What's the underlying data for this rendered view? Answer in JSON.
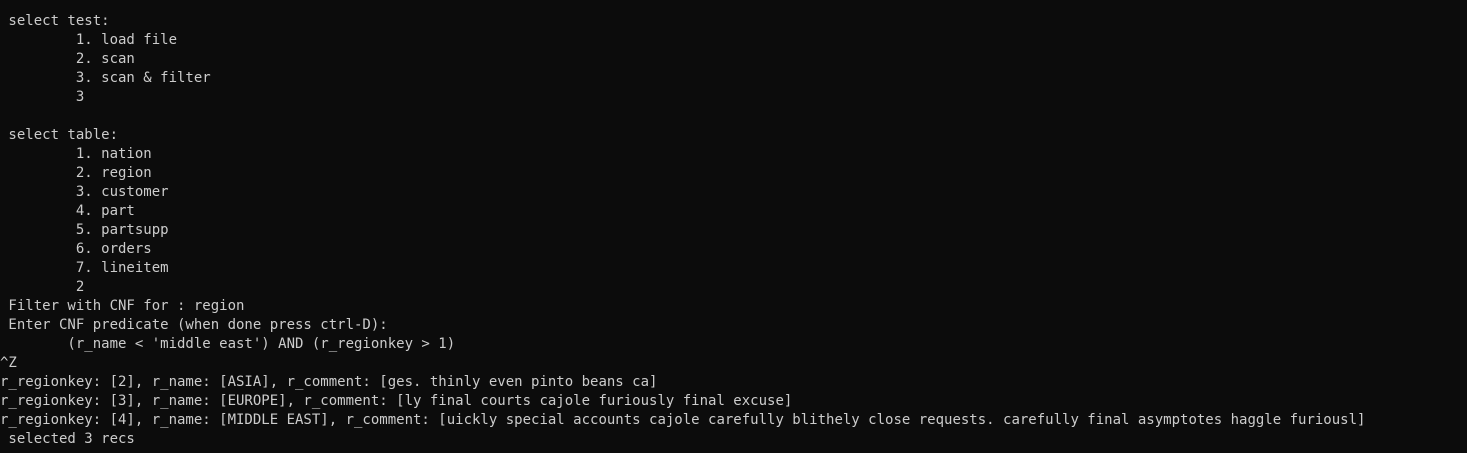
{
  "terminal": {
    "lines": [
      " select test:",
      "         1. load file",
      "         2. scan",
      "         3. scan & filter",
      "         3",
      "",
      " select table:",
      "         1. nation",
      "         2. region",
      "         3. customer",
      "         4. part",
      "         5. partsupp",
      "         6. orders",
      "         7. lineitem",
      "         2",
      " Filter with CNF for : region",
      " Enter CNF predicate (when done press ctrl-D):",
      "        (r_name < 'middle east') AND (r_regionkey > 1)",
      "^Z",
      "r_regionkey: [2], r_name: [ASIA], r_comment: [ges. thinly even pinto beans ca]",
      "r_regionkey: [3], r_name: [EUROPE], r_comment: [ly final courts cajole furiously final excuse]",
      "r_regionkey: [4], r_name: [MIDDLE EAST], r_comment: [uickly special accounts cajole carefully blithely close requests. carefully final asymptotes haggle furiousl]",
      " selected 3 recs"
    ]
  }
}
